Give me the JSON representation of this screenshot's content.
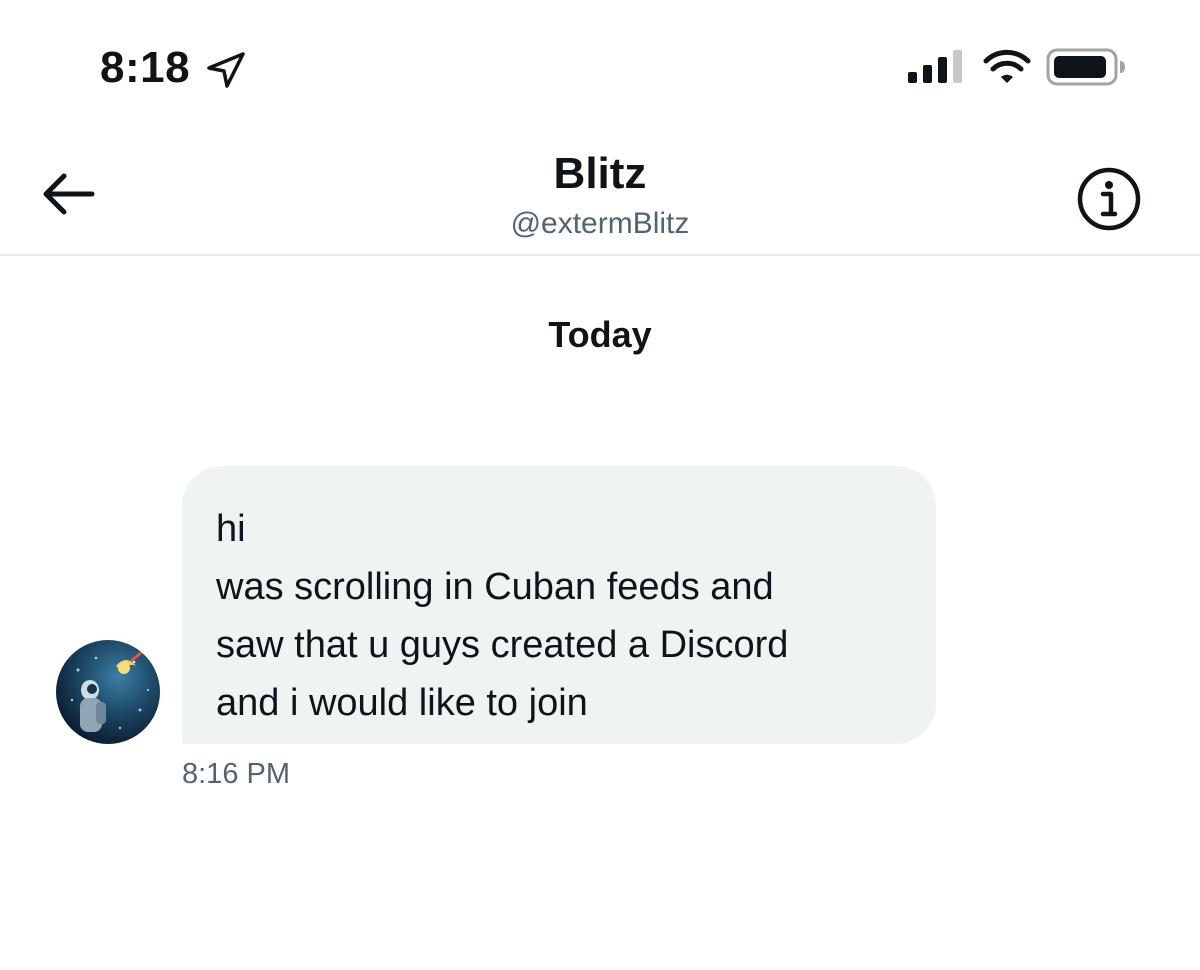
{
  "status_bar": {
    "time": "8:18",
    "icons": {
      "location": "location-arrow-icon",
      "signal": "cellular-signal-icon",
      "wifi": "wifi-icon",
      "battery": "battery-icon"
    }
  },
  "header": {
    "name": "Blitz",
    "handle": "@extermBlitz",
    "icons": {
      "back": "back-arrow-icon",
      "info": "info-icon"
    }
  },
  "conversation": {
    "date_label": "Today",
    "messages": [
      {
        "lines": [
          "hi",
          "was scrolling in Cuban feeds and",
          "saw that u guys created a Discord",
          "and i would like to join"
        ],
        "time": "8:16 PM"
      }
    ]
  },
  "colors": {
    "text_primary": "#0f1419",
    "text_secondary": "#536471",
    "bubble_background": "#eff3f4",
    "divider": "#e6e9eb"
  }
}
